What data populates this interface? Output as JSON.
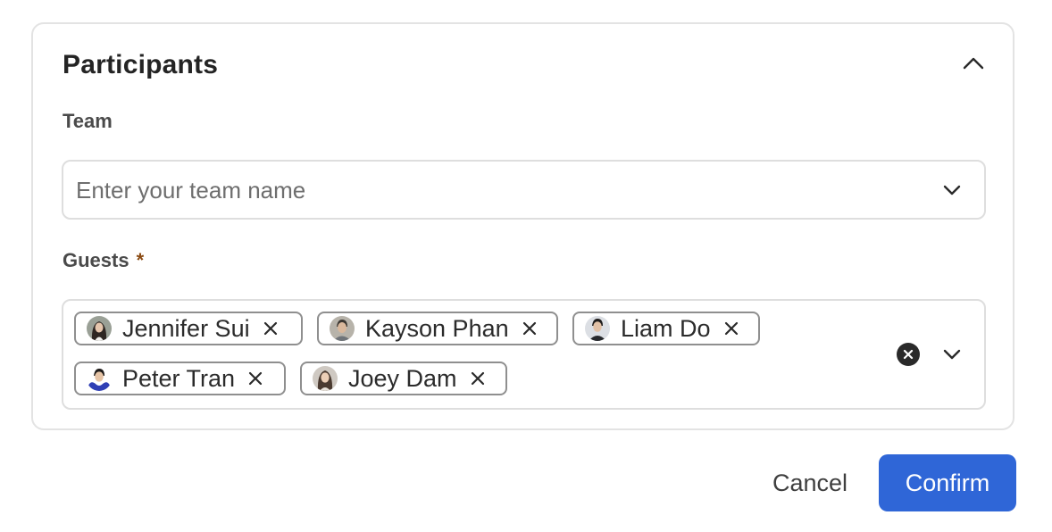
{
  "panel": {
    "title": "Participants",
    "collapse_icon": "chevron-up-icon"
  },
  "team": {
    "label": "Team",
    "placeholder": "Enter your team name",
    "value": "",
    "dropdown_icon": "chevron-down-icon"
  },
  "guests": {
    "label": "Guests",
    "required_marker": "*",
    "selected": [
      {
        "name": "Jennifer Sui",
        "avatar_icon": "avatar-jennifer-sui"
      },
      {
        "name": "Kayson Phan",
        "avatar_icon": "avatar-kayson-phan"
      },
      {
        "name": "Liam Do",
        "avatar_icon": "avatar-liam-do"
      },
      {
        "name": "Peter Tran",
        "avatar_icon": "avatar-peter-tran"
      },
      {
        "name": "Joey Dam",
        "avatar_icon": "avatar-joey-dam"
      }
    ],
    "remove_icon": "close-icon",
    "clear_icon": "clear-circle-icon",
    "dropdown_icon": "chevron-down-icon"
  },
  "actions": {
    "cancel_label": "Cancel",
    "confirm_label": "Confirm"
  },
  "colors": {
    "accent": "#2f66d7",
    "border": "#e3e3e3",
    "chip_border": "#8f8f8f",
    "required": "#8a4a12"
  }
}
